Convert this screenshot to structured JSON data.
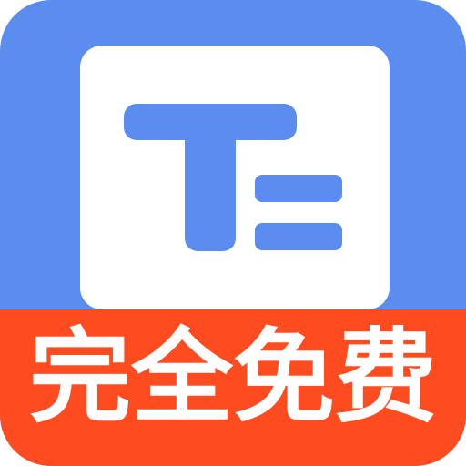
{
  "icon": {
    "glyph": "text-document-icon",
    "background_color": "#5b8def",
    "card_color": "#ffffff",
    "glyph_color": "#5b8def"
  },
  "banner": {
    "text": "完全免费",
    "background_color": "#fe4b1f",
    "text_color": "#ffffff"
  }
}
